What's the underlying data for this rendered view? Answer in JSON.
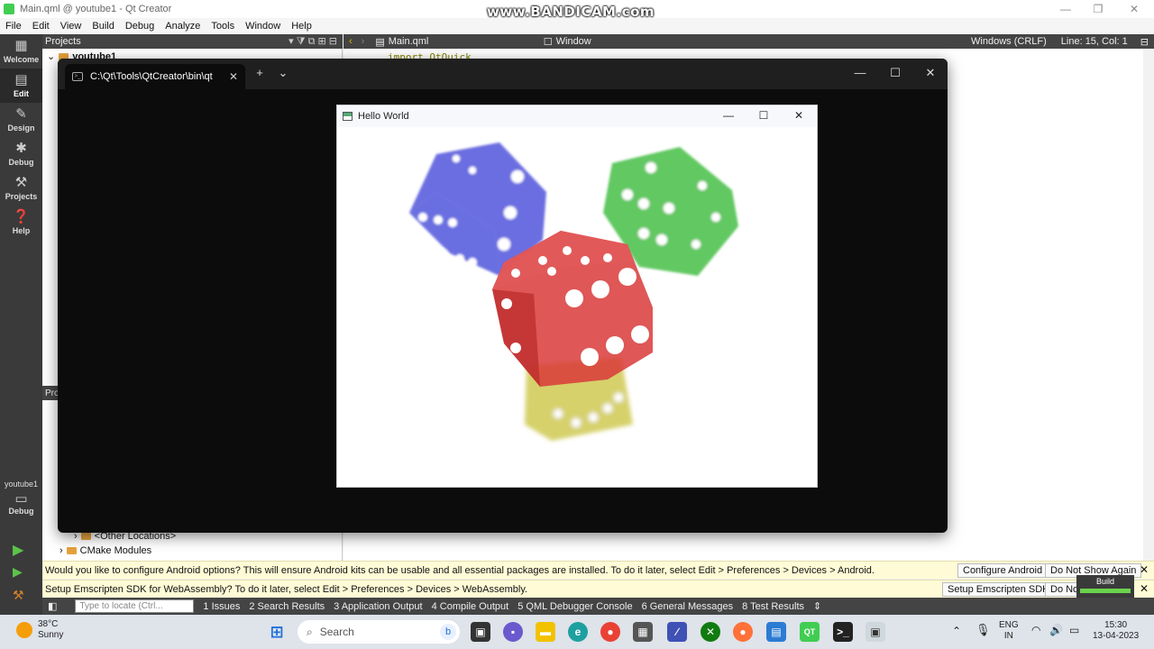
{
  "window": {
    "title": "Main.qml @ youtube1 - Qt Creator",
    "watermark": "www.BANDICAM.com"
  },
  "menu": [
    "File",
    "Edit",
    "View",
    "Build",
    "Debug",
    "Analyze",
    "Tools",
    "Window",
    "Help"
  ],
  "modes": [
    {
      "label": "Welcome",
      "icon": "grid-icon"
    },
    {
      "label": "Edit",
      "icon": "edit-icon"
    },
    {
      "label": "Design",
      "icon": "pen-icon"
    },
    {
      "label": "Debug",
      "icon": "bug-icon"
    },
    {
      "label": "Projects",
      "icon": "wrench-icon"
    },
    {
      "label": "Help",
      "icon": "help-icon"
    }
  ],
  "kit": {
    "project": "youtube1",
    "mode": "Debug"
  },
  "projects": {
    "header": "Projects",
    "root": "youtube1",
    "sub_header": "Pro",
    "other_locations": "<Other Locations>",
    "cmake_modules": "CMake Modules"
  },
  "editor": {
    "file": "Main.qml",
    "symbol": "Window",
    "line_ending": "Windows (CRLF)",
    "position": "Line: 15, Col: 1",
    "code": "import QtQuick"
  },
  "terminal": {
    "tab_title": "C:\\Qt\\Tools\\QtCreator\\bin\\qt"
  },
  "hello": {
    "title": "Hello World"
  },
  "notifications": [
    {
      "text": "Would you like to configure Android options? This will ensure Android kits can be usable and all essential packages are installed. To do it later, select Edit > Preferences > Devices > Android.",
      "action": "Configure Android",
      "dismiss": "Do Not Show Again"
    },
    {
      "text": "Setup Emscripten SDK for WebAssembly? To do it later, select Edit > Preferences > Devices > WebAssembly.",
      "action": "Setup Emscripten SDK",
      "dismiss": "Do Not"
    }
  ],
  "output": {
    "locator_placeholder": "Type to locate (Ctrl...",
    "tabs": [
      "1  Issues",
      "2  Search Results",
      "3  Application Output",
      "4  Compile Output",
      "5  QML Debugger Console",
      "6  General Messages",
      "8  Test Results"
    ]
  },
  "build": {
    "label": "Build",
    "progress": 1.0
  },
  "taskbar": {
    "temperature": "38°C",
    "weather": "Sunny",
    "search": "Search",
    "lang": "ENG",
    "region": "IN",
    "time": "15:30",
    "date": "13-04-2023"
  },
  "colors": {
    "dice_blue": "#3b3fd6",
    "dice_green": "#2fb52f",
    "dice_red": "#d93a3a",
    "dice_yellow": "#c8c23a",
    "build_progress": "#6bd34d"
  }
}
